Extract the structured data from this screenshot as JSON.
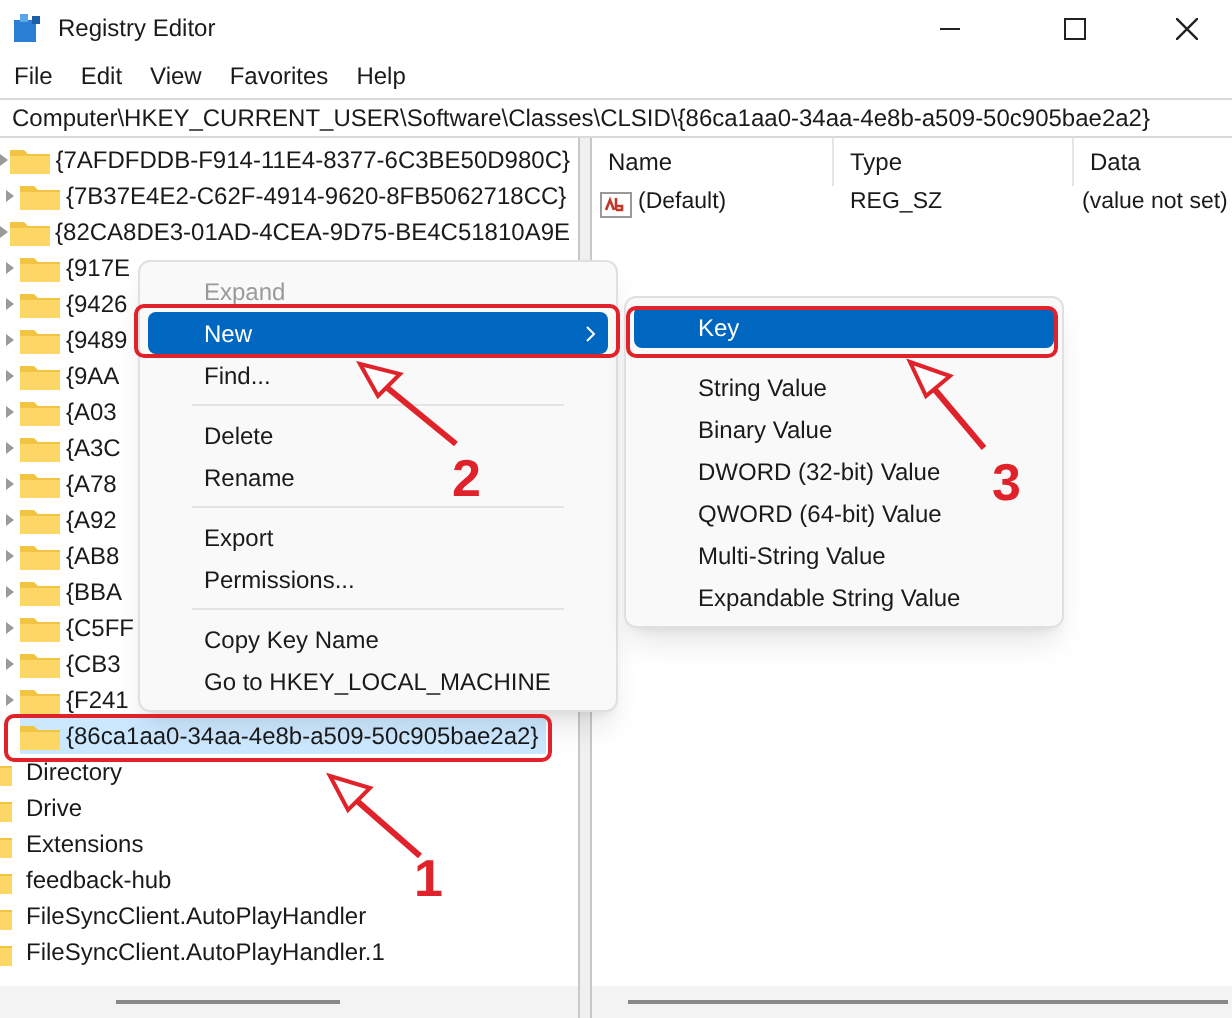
{
  "window": {
    "title": "Registry Editor"
  },
  "menu_bar": [
    "File",
    "Edit",
    "View",
    "Favorites",
    "Help"
  ],
  "address_bar": "Computer\\HKEY_CURRENT_USER\\Software\\Classes\\CLSID\\{86ca1aa0-34aa-4e8b-a509-50c905bae2a2}",
  "tree": {
    "nested_items": [
      {
        "label": "{7AFDFDDB-F914-11E4-8377-6C3BE50D980C}",
        "expandable": true,
        "selected": false
      },
      {
        "label": "{7B37E4E2-C62F-4914-9620-8FB5062718CC}",
        "expandable": true,
        "selected": false
      },
      {
        "label": "{82CA8DE3-01AD-4CEA-9D75-BE4C51810A9E",
        "expandable": true,
        "selected": false
      },
      {
        "label": "{917E",
        "expandable": true,
        "selected": false
      },
      {
        "label": "{9426",
        "expandable": true,
        "selected": false
      },
      {
        "label": "{9489",
        "expandable": true,
        "selected": false
      },
      {
        "label": "{9AA",
        "expandable": true,
        "selected": false
      },
      {
        "label": "{A03",
        "expandable": true,
        "selected": false
      },
      {
        "label": "{A3C",
        "expandable": true,
        "selected": false
      },
      {
        "label": "{A78",
        "expandable": true,
        "selected": false
      },
      {
        "label": "{A92",
        "expandable": true,
        "selected": false
      },
      {
        "label": "{AB8",
        "expandable": true,
        "selected": false
      },
      {
        "label": "{BBA",
        "expandable": true,
        "selected": false
      },
      {
        "label": "{C5FF",
        "expandable": true,
        "selected": false
      },
      {
        "label": "{CB3",
        "expandable": true,
        "selected": false
      },
      {
        "label": "{F241",
        "expandable": true,
        "selected": false
      },
      {
        "label": "{86ca1aa0-34aa-4e8b-a509-50c905bae2a2}",
        "expandable": false,
        "selected": true
      }
    ],
    "items": [
      {
        "label": "Directory",
        "selected": false
      },
      {
        "label": "Drive",
        "selected": false
      },
      {
        "label": "Extensions",
        "selected": false
      },
      {
        "label": "feedback-hub",
        "selected": false
      },
      {
        "label": "FileSyncClient.AutoPlayHandler",
        "selected": false
      },
      {
        "label": "FileSyncClient.AutoPlayHandler.1",
        "selected": false
      }
    ]
  },
  "values_table": {
    "columns": [
      "Name",
      "Type",
      "Data"
    ],
    "rows": [
      [
        "(Default)",
        "REG_SZ",
        "(value not set)"
      ]
    ]
  },
  "context_menu": [
    {
      "kind": "item",
      "label": "Expand",
      "disabled": true,
      "selected": false,
      "submenu": false
    },
    {
      "kind": "item",
      "label": "New",
      "disabled": false,
      "selected": true,
      "submenu": true
    },
    {
      "kind": "item",
      "label": "Find...",
      "disabled": false,
      "selected": false,
      "submenu": false
    },
    {
      "kind": "separator"
    },
    {
      "kind": "item",
      "label": "Delete",
      "disabled": false,
      "selected": false,
      "submenu": false
    },
    {
      "kind": "item",
      "label": "Rename",
      "disabled": false,
      "selected": false,
      "submenu": false
    },
    {
      "kind": "separator"
    },
    {
      "kind": "item",
      "label": "Export",
      "disabled": false,
      "selected": false,
      "submenu": false
    },
    {
      "kind": "item",
      "label": "Permissions...",
      "disabled": false,
      "selected": false,
      "submenu": false
    },
    {
      "kind": "separator"
    },
    {
      "kind": "item",
      "label": "Copy Key Name",
      "disabled": false,
      "selected": false,
      "submenu": false
    },
    {
      "kind": "item",
      "label": "Go to HKEY_LOCAL_MACHINE",
      "disabled": false,
      "selected": false,
      "submenu": false
    }
  ],
  "submenu": [
    {
      "kind": "item",
      "label": "Key",
      "selected": true
    },
    {
      "kind": "separator"
    },
    {
      "kind": "item",
      "label": "String Value",
      "selected": false
    },
    {
      "kind": "item",
      "label": "Binary Value",
      "selected": false
    },
    {
      "kind": "item",
      "label": "DWORD (32-bit) Value",
      "selected": false
    },
    {
      "kind": "item",
      "label": "QWORD (64-bit) Value",
      "selected": false
    },
    {
      "kind": "item",
      "label": "Multi-String Value",
      "selected": false
    },
    {
      "kind": "item",
      "label": "Expandable String Value",
      "selected": false
    }
  ],
  "annotations": [
    {
      "label": "1"
    },
    {
      "label": "2"
    },
    {
      "label": "3"
    }
  ]
}
